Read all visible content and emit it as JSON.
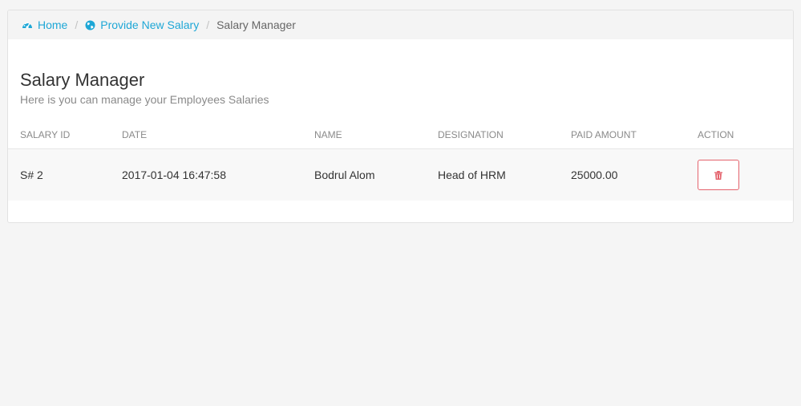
{
  "breadcrumb": {
    "home_label": "Home",
    "home_icon": "dashboard-icon",
    "provide_label": "Provide New Salary",
    "provide_icon": "globe-icon",
    "separator": "/",
    "current_label": "Salary Manager"
  },
  "page": {
    "title": "Salary Manager",
    "subtitle": "Here is you can manage your Employees Salaries"
  },
  "table": {
    "columns": [
      "SALARY ID",
      "DATE",
      "NAME",
      "DESIGNATION",
      "PAID AMOUNT",
      "ACTION"
    ],
    "rows": [
      {
        "salary_id": "S# 2",
        "date": "2017-01-04 16:47:58",
        "name": "Bodrul Alom",
        "designation": "Head of HRM",
        "paid_amount": "25000.00",
        "action_icon": "trash-icon"
      }
    ]
  },
  "colors": {
    "link": "#1ea7d6",
    "danger": "#e4636d",
    "background": "#f5f5f5"
  }
}
